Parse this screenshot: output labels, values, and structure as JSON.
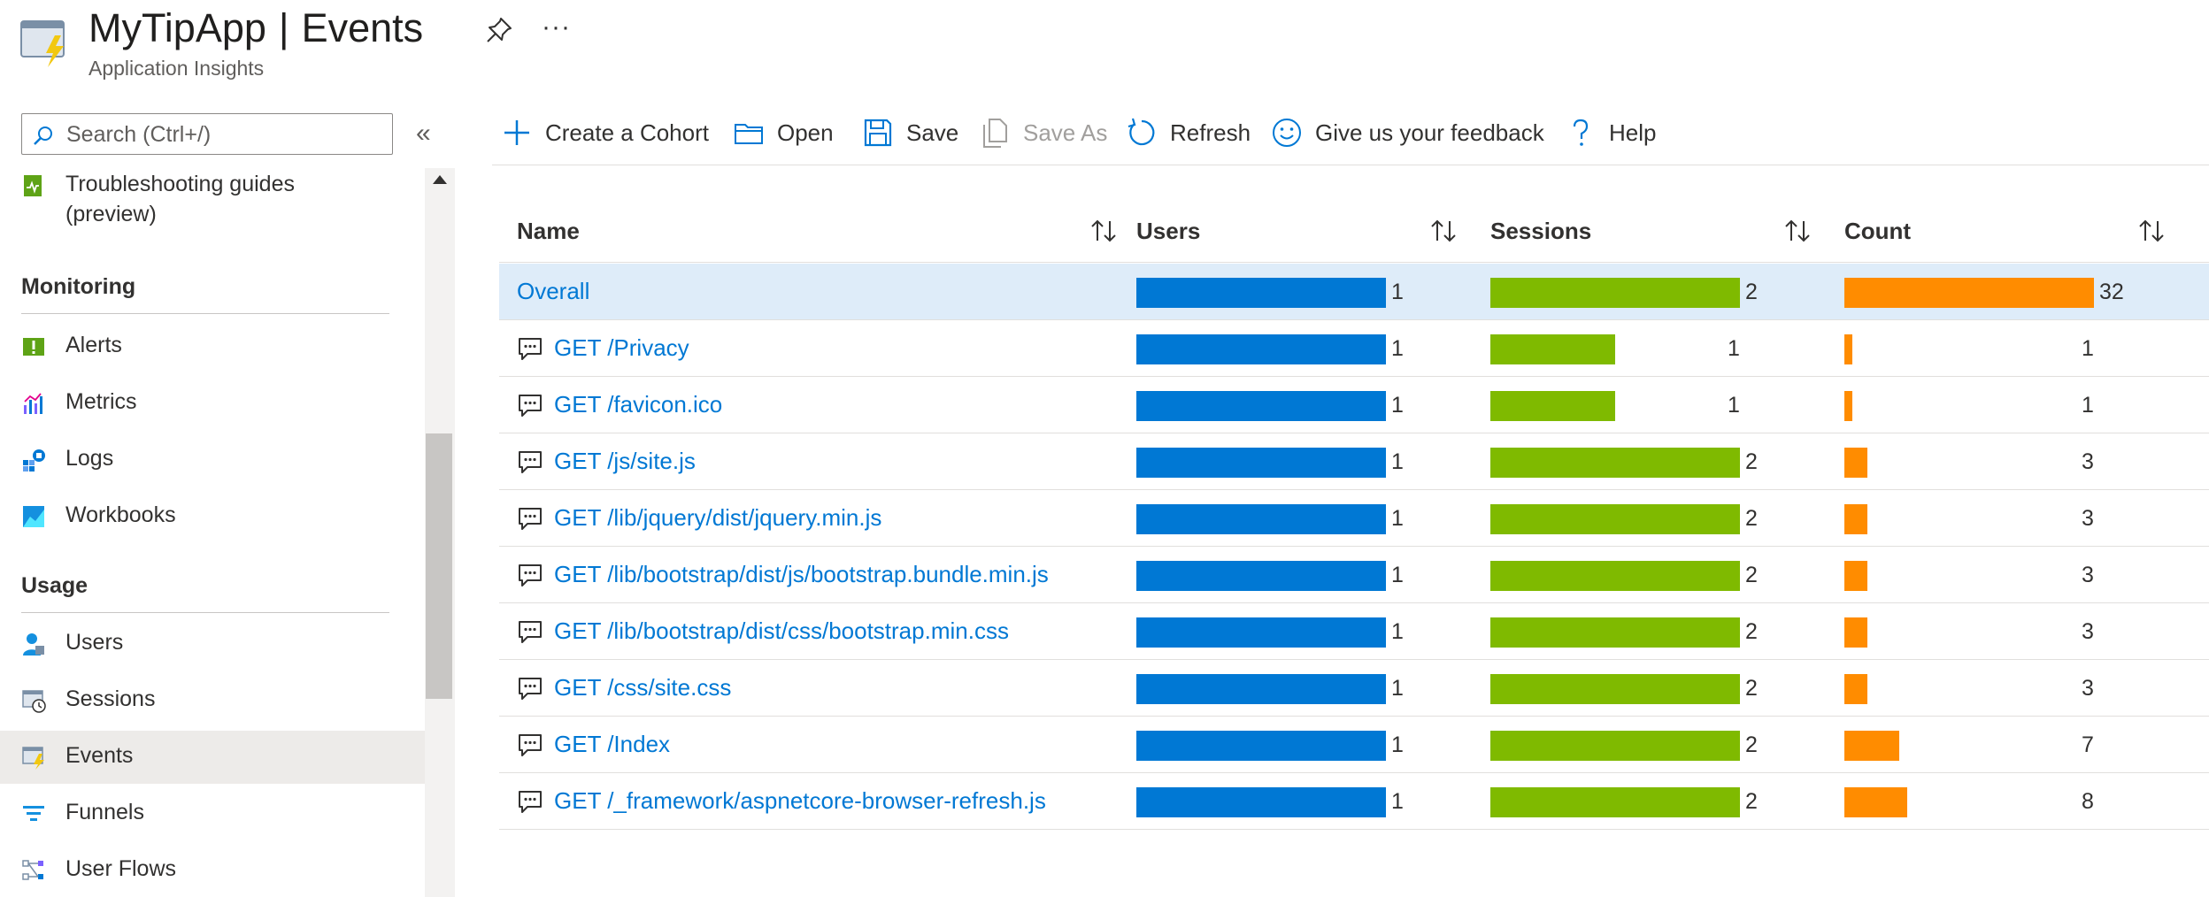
{
  "header": {
    "app_name": "MyTipApp",
    "separator": "|",
    "page_name": "Events",
    "subtitle": "Application Insights",
    "more_label": "···"
  },
  "sidebar": {
    "search_placeholder": "Search (Ctrl+/)",
    "collapse_label": "«",
    "top_item_line1": "Troubleshooting guides",
    "top_item_line2": "(preview)",
    "groups": {
      "monitoring": "Monitoring",
      "usage": "Usage"
    },
    "items": {
      "alerts": "Alerts",
      "metrics": "Metrics",
      "logs": "Logs",
      "workbooks": "Workbooks",
      "users": "Users",
      "sessions": "Sessions",
      "events": "Events",
      "funnels": "Funnels",
      "user_flows": "User Flows"
    },
    "active_item": "Events"
  },
  "toolbar": {
    "create_cohort": "Create a Cohort",
    "open": "Open",
    "save": "Save",
    "save_as": "Save As",
    "refresh": "Refresh",
    "feedback": "Give us your feedback",
    "help": "Help"
  },
  "table": {
    "columns": {
      "name": "Name",
      "users": "Users",
      "sessions": "Sessions",
      "count": "Count"
    },
    "max": {
      "users": 1,
      "sessions": 2,
      "count": 32
    },
    "rows": [
      {
        "name": "Overall",
        "users": "1",
        "sessions": "2",
        "count": "32",
        "icon": ""
      },
      {
        "name": "GET /Privacy",
        "users": "1",
        "sessions": "1",
        "count": "1",
        "icon": "message-icon"
      },
      {
        "name": "GET /favicon.ico",
        "users": "1",
        "sessions": "1",
        "count": "1",
        "icon": "message-icon"
      },
      {
        "name": "GET /js/site.js",
        "users": "1",
        "sessions": "2",
        "count": "3",
        "icon": "message-icon"
      },
      {
        "name": "GET /lib/jquery/dist/jquery.min.js",
        "users": "1",
        "sessions": "2",
        "count": "3",
        "icon": "message-icon"
      },
      {
        "name": "GET /lib/bootstrap/dist/js/bootstrap.bundle.min.js",
        "users": "1",
        "sessions": "2",
        "count": "3",
        "icon": "message-icon"
      },
      {
        "name": "GET /lib/bootstrap/dist/css/bootstrap.min.css",
        "users": "1",
        "sessions": "2",
        "count": "3",
        "icon": "message-icon"
      },
      {
        "name": "GET /css/site.css",
        "users": "1",
        "sessions": "2",
        "count": "3",
        "icon": "message-icon"
      },
      {
        "name": "GET /Index",
        "users": "1",
        "sessions": "2",
        "count": "7",
        "icon": "message-icon"
      },
      {
        "name": "GET /_framework/aspnetcore-browser-refresh.js",
        "users": "1",
        "sessions": "2",
        "count": "8",
        "icon": "message-icon"
      }
    ]
  },
  "colors": {
    "users_bar": "#0078d4",
    "sessions_bar": "#7fba00",
    "count_bar": "#ff8c00",
    "link": "#0078d4",
    "selected_row": "#deecf9"
  }
}
